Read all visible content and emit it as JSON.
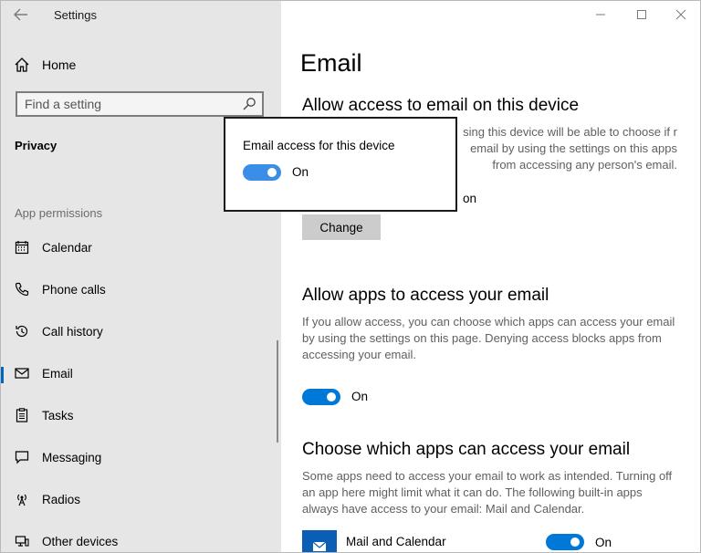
{
  "window": {
    "title": "Settings"
  },
  "sidebar": {
    "home_label": "Home",
    "search_placeholder": "Find a setting",
    "section_title": "Privacy",
    "group_header": "App permissions",
    "items": [
      {
        "label": "Calendar",
        "icon": "calendar-icon"
      },
      {
        "label": "Phone calls",
        "icon": "phone-icon"
      },
      {
        "label": "Call history",
        "icon": "history-icon"
      },
      {
        "label": "Email",
        "icon": "email-icon",
        "active": true
      },
      {
        "label": "Tasks",
        "icon": "tasks-icon"
      },
      {
        "label": "Messaging",
        "icon": "messaging-icon"
      },
      {
        "label": "Radios",
        "icon": "radios-icon"
      },
      {
        "label": "Other devices",
        "icon": "devices-icon"
      }
    ]
  },
  "main": {
    "page_title": "Email",
    "section1": {
      "heading": "Allow access to email on this device",
      "desc_fragment": "sing this device will be able to choose if r email by using the settings on this apps from accessing any person's email.",
      "status_fragment": "on",
      "change_label": "Change"
    },
    "section2": {
      "heading": "Allow apps to access your email",
      "description": "If you allow access, you can choose which apps can access your email by using the settings on this page. Denying access blocks apps from accessing your email.",
      "toggle_label": "On",
      "toggle_on": true
    },
    "section3": {
      "heading": "Choose which apps can access your email",
      "description": "Some apps need to access your email to work as intended. Turning off an app here might limit what it can do. The following built-in apps always have access to your email: Mail and Calendar.",
      "apps": [
        {
          "name": "Mail and Calendar",
          "toggle_label": "On",
          "toggle_on": true
        }
      ]
    }
  },
  "flyout": {
    "title": "Email access for this device",
    "toggle_label": "On",
    "toggle_on": true
  },
  "colors": {
    "accent": "#0078d7",
    "sidebar_bg": "#e6e6e6"
  }
}
